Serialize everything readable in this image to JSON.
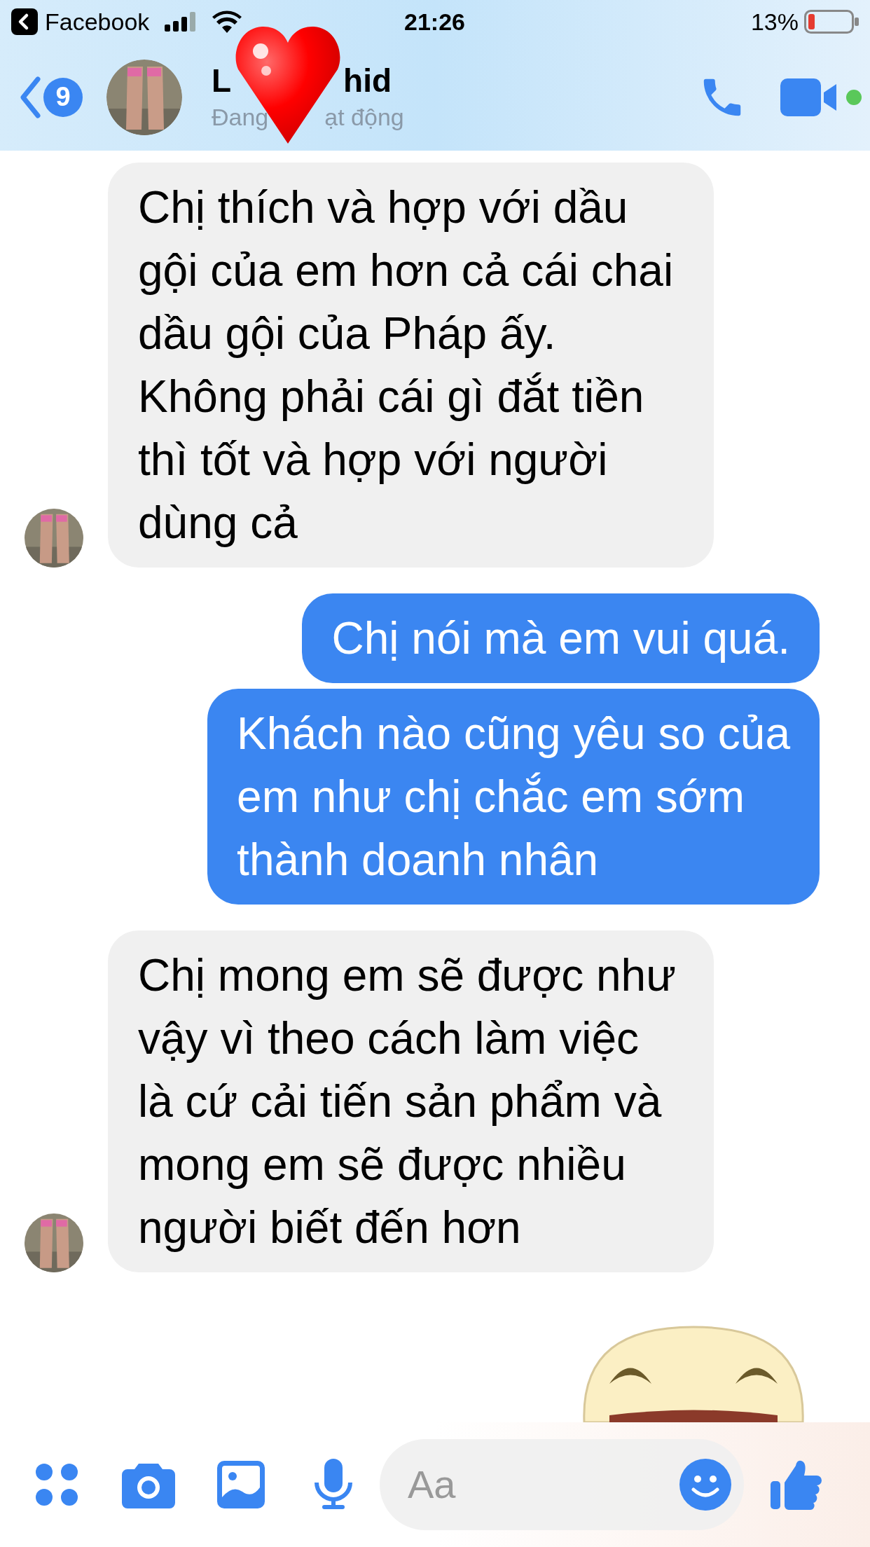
{
  "status_bar": {
    "back_app": "Facebook",
    "time": "21:26",
    "battery": "13%"
  },
  "header": {
    "unread_count": "9",
    "name_parts": [
      "L",
      "hid"
    ],
    "status_parts": [
      "Đang",
      "ạt động"
    ],
    "online": true
  },
  "messages": [
    {
      "kind": "incoming",
      "lines": [
        "Chị thích và hợp với dầu",
        "gội của em hơn cả cái chai",
        "dầu gội của Pháp ấy.",
        "Không phải cái gì đắt tiền",
        "thì tốt và hợp với người",
        "dùng cả"
      ]
    },
    {
      "kind": "outgoing",
      "lines": [
        "Chị nói mà em vui quá."
      ]
    },
    {
      "kind": "outgoing",
      "lines": [
        "Khách nào cũng yêu so của",
        "em như chị chắc em sớm",
        "thành doanh nhân"
      ]
    },
    {
      "kind": "incoming",
      "lines": [
        "Chị mong em sẽ được như",
        "vậy vì theo cách làm việc",
        "là cứ cải tiến sản phẩm và",
        "mong em sẽ được nhiều",
        "người biết đến hơn"
      ]
    }
  ],
  "composer": {
    "placeholder": "Aa"
  }
}
